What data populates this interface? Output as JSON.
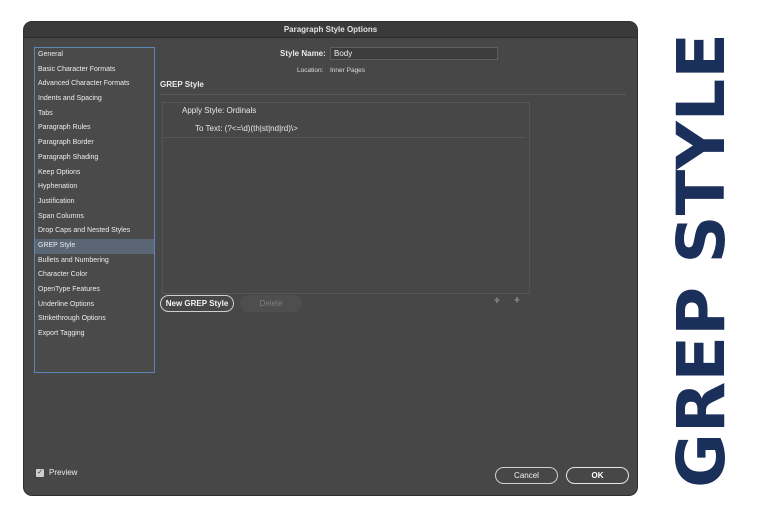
{
  "dialog": {
    "title": "Paragraph Style Options",
    "style_name_label": "Style Name:",
    "style_name_value": "Body",
    "location_label": "Location:",
    "location_value": "Inner Pages",
    "section_title": "GREP Style",
    "grep": {
      "apply_style_label": "Apply Style:",
      "apply_style_value": "Ordinals",
      "to_text_label": "To Text:",
      "to_text_value": "(?<=\\d)(th|st|nd|rd)\\>"
    },
    "buttons": {
      "new_grep": "New GREP Style",
      "delete": "Delete",
      "cancel": "Cancel",
      "ok": "OK",
      "move_up_icon": "up-arrow-icon",
      "move_down_icon": "down-arrow-icon"
    },
    "preview_label": "Preview",
    "preview_checked": true
  },
  "sidebar": {
    "selected_index": 13,
    "items": [
      "General",
      "Basic Character Formats",
      "Advanced Character Formats",
      "Indents and Spacing",
      "Tabs",
      "Paragraph Rules",
      "Paragraph Border",
      "Paragraph Shading",
      "Keep Options",
      "Hyphenation",
      "Justification",
      "Span Columns",
      "Drop Caps and Nested Styles",
      "GREP Style",
      "Bullets and Numbering",
      "Character Color",
      "OpenType Features",
      "Underline Options",
      "Strikethrough Options",
      "Export Tagging"
    ]
  },
  "banner": {
    "text": "GREP STYLE",
    "color": "#1a2f5a"
  }
}
